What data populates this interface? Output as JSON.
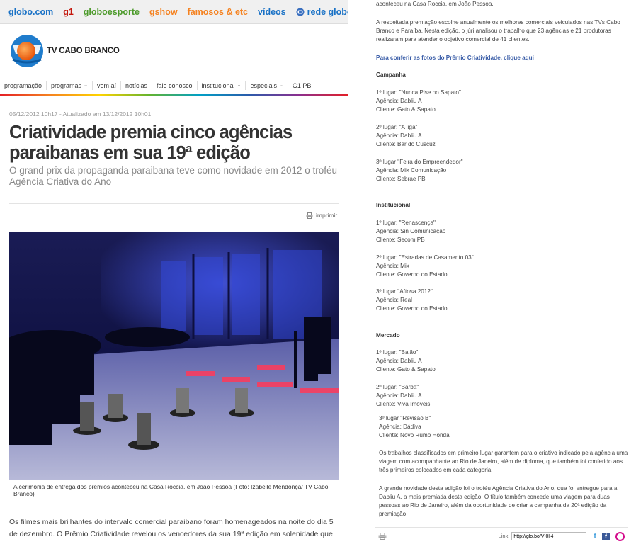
{
  "globo_bar": {
    "links": [
      {
        "label": "globo.com",
        "color": "#1a72c6"
      },
      {
        "label": "g1",
        "color": "#c4170c"
      },
      {
        "label": "globoesporte",
        "color": "#4c9a2a"
      },
      {
        "label": "gshow",
        "color": "#f58220"
      },
      {
        "label": "famosos & etc",
        "color": "#f58220"
      },
      {
        "label": "vídeos",
        "color": "#1a72c6"
      },
      {
        "label": "rede globo",
        "color": "#1a72c6"
      }
    ]
  },
  "header": {
    "brand": "TV CABO BRANCO"
  },
  "nav": {
    "items": [
      {
        "label": "programação",
        "dropdown": false
      },
      {
        "label": "programas",
        "dropdown": true
      },
      {
        "label": "vem aí",
        "dropdown": false
      },
      {
        "label": "notícias",
        "dropdown": false
      },
      {
        "label": "fale conosco",
        "dropdown": false
      },
      {
        "label": "institucional",
        "dropdown": true
      },
      {
        "label": "especiais",
        "dropdown": true
      },
      {
        "label": "G1 PB",
        "dropdown": false
      }
    ]
  },
  "article": {
    "meta": "05/12/2012 10h17 - Atualizado em 13/12/2012 10h01",
    "title": "Criatividade premia cinco agências paraibanas em sua 19ª edição",
    "subtitle": "O grand prix da propaganda paraibana teve como novidade em 2012 o troféu Agência Criativa do Ano",
    "print_label": "imprimir",
    "caption": "A cerimônia de entrega dos prêmios aconteceu  na Casa Roccia, em João Pessoa (Foto: Izabelle Mendonça/ TV Cabo Branco)",
    "body_start": "Os filmes mais brilhantes do intervalo comercial paraibano foram homenageados na noite do dia 5 de dezembro. O Prêmio Criatividade revelou os vencedores da sua 19ª edição em solenidade que"
  },
  "right": {
    "cont": "aconteceu na Casa Roccia, em João Pessoa.",
    "intro": "A respeitada premiação escolhe anualmente os melhores comerciais veiculados nas TVs Cabo Branco e Paraíba. Nesta edição, o júri analisou o trabalho que 23 agências e 21 produtoras realizaram para atender o objetivo comercial de 41 clientes.",
    "photos_link": "Para conferir as fotos do Prêmio Criatividade, clique aqui",
    "categories": [
      {
        "name": "Campanha",
        "entries": [
          {
            "place": "1º lugar: \"Nunca Pise no Sapato\"",
            "agency": "Agência: Dabliu A",
            "client": "Cliente: Gato & Sapato"
          },
          {
            "place": "2º lugar: \"A liga\"",
            "agency": "Agência: Dabliu A",
            "client": "Cliente: Bar do Cuscuz"
          },
          {
            "place": "3º lugar \"Feira do Empreendedor\"",
            "agency": "Agência: Mix Comunicação",
            "client": "Cliente: Sebrae PB"
          }
        ]
      },
      {
        "name": "Institucional",
        "entries": [
          {
            "place": "1º lugar: \"Renascença\"",
            "agency": "Agência: Sin Comunicação",
            "client": "Cliente: Secom PB"
          },
          {
            "place": "2º lugar: \"Estradas de Casamento 03\"",
            "agency": "Agência: Mix",
            "client": "Cliente: Governo do Estado"
          },
          {
            "place": "3º lugar \"Aftosa 2012\"",
            "agency": "Agência: Real",
            "client": "Cliente: Governo do Estado"
          }
        ]
      },
      {
        "name": "Mercado",
        "entries": [
          {
            "place": "1º lugar: \"Balão\"",
            "agency": "Agência: Dabliu A",
            "client": "Cliente: Gato & Sapato"
          },
          {
            "place": "2º lugar: \"Barba\"",
            "agency": "Agência: Dabliu A",
            "client": "Cliente: Viva Imóveis"
          },
          {
            "place": "3º lugar \"Revisão B\"",
            "agency": "Agência: Dádiva",
            "client": "Cliente: Novo Rumo Honda"
          }
        ]
      }
    ],
    "para1": "Os trabalhos classificados em primeiro lugar garantem para o criativo indicado pela agência uma viagem com acompanhante ao Rio de Janeiro, além de diploma, que também foi conferido aos três primeiros colocados em cada categoria.",
    "para2": "A grande novidade desta edição foi o troféu Agência Criativa do Ano, que foi entregue para a Dabliu A, a mais premiada desta edição. O título também concede uma viagem para duas pessoas ao Rio de Janeiro, além da oportunidade de criar a campanha da 20ª edição da premiação.",
    "footer": {
      "link_label": "Link",
      "link_value": "http://glo.bo/VI0li4"
    }
  }
}
